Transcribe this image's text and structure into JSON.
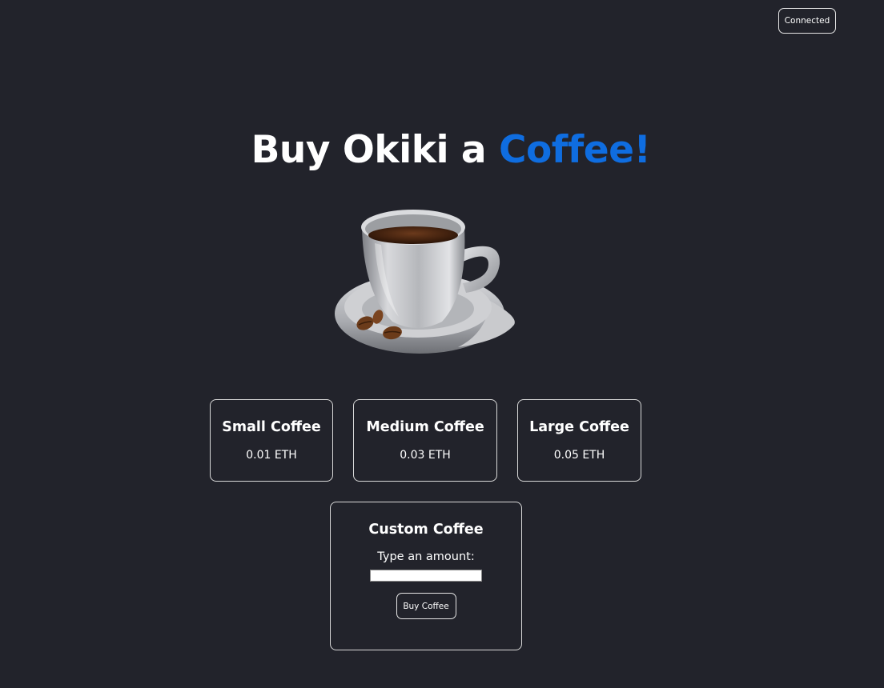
{
  "header": {
    "connect_label": "Connected"
  },
  "hero": {
    "title_prefix": "Buy Okiki a ",
    "title_accent": "Coffee!",
    "accent_color": "#0f6de0",
    "image": "coffee-cup-with-beans"
  },
  "options": [
    {
      "name": "Small Coffee",
      "price": "0.01 ETH"
    },
    {
      "name": "Medium Coffee",
      "price": "0.03 ETH"
    },
    {
      "name": "Large Coffee",
      "price": "0.05 ETH"
    }
  ],
  "custom": {
    "title": "Custom Coffee",
    "label": "Type an amount:",
    "input_value": "",
    "button_label": "Buy Coffee"
  },
  "colors": {
    "background": "#22232b",
    "border": "#d9d9d9",
    "text": "#ffffff"
  }
}
